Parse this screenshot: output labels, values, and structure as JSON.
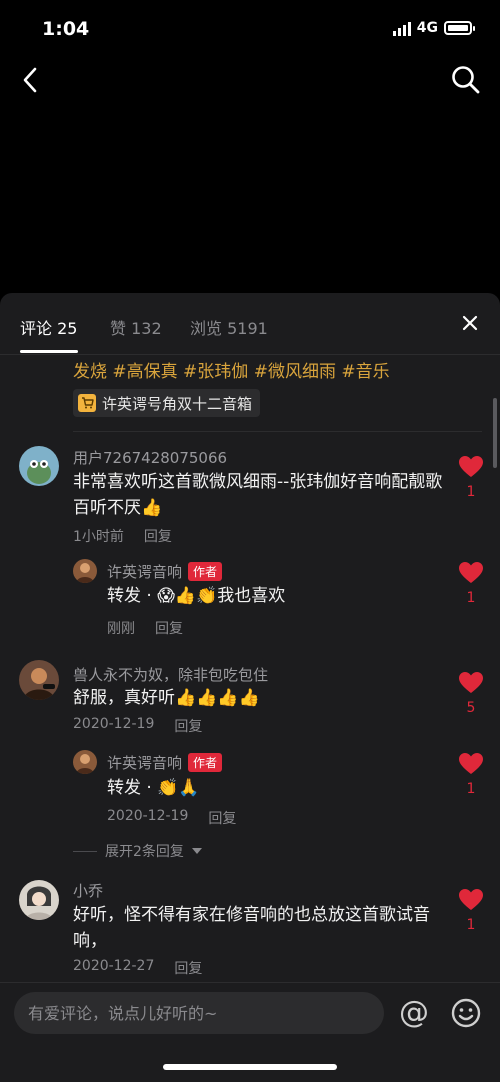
{
  "status": {
    "time": "1:04",
    "network": "4G"
  },
  "tabs": [
    {
      "label": "评论 25"
    },
    {
      "label": "赞 132"
    },
    {
      "label": "浏览 5191"
    }
  ],
  "post": {
    "hashtags": "发烧 #高保真 #张玮伽 #微风细雨 #音乐",
    "product_tag": "许英谔号角双十二音箱"
  },
  "comments": [
    {
      "user": "用户7267428075066",
      "text": "非常喜欢听这首歌微风细雨--张玮伽好音响配靓歌百听不厌👍",
      "time": "1小时前",
      "reply_label": "回复",
      "likes": "1",
      "replies": [
        {
          "user": "许英谔音响",
          "badge": "作者",
          "text": "转发 · 😱👍👏我也喜欢",
          "time": "刚刚",
          "reply_label": "回复",
          "likes": "1"
        }
      ]
    },
    {
      "user": "兽人永不为奴，除非包吃包住",
      "text": "舒服，真好听👍👍👍👍",
      "time": "2020-12-19",
      "reply_label": "回复",
      "likes": "5",
      "replies": [
        {
          "user": "许英谔音响",
          "badge": "作者",
          "text": "转发 · 👏🙏",
          "time": "2020-12-19",
          "reply_label": "回复",
          "likes": "1"
        }
      ],
      "expand_label": "展开2条回复"
    },
    {
      "user": "小乔",
      "text": "好听，怪不得有家在修音响的也总放这首歌试音响，",
      "time": "2020-12-27",
      "reply_label": "回复",
      "likes": "1"
    }
  ],
  "input": {
    "placeholder": "有爱评论，说点儿好听的~"
  },
  "colors": {
    "accent": "#e0283a",
    "hashtag": "#d9a43c",
    "sheet_bg": "#1c1c1e"
  }
}
